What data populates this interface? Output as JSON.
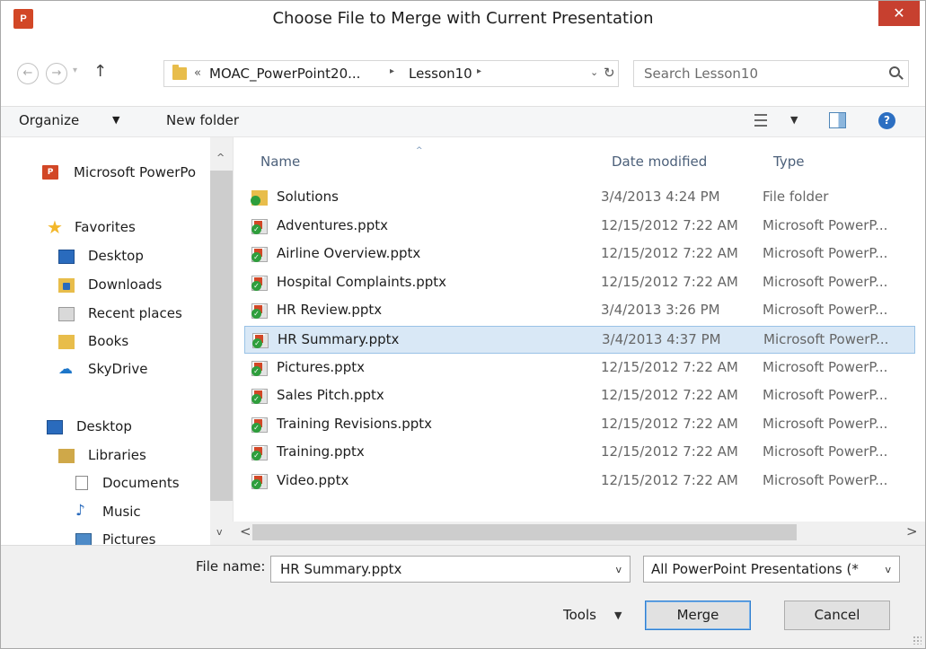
{
  "window": {
    "title": "Choose File to Merge with Current Presentation",
    "app_icon_text": "P",
    "close_label": "✕"
  },
  "navigation": {
    "back_label": "←",
    "forward_label": "→",
    "recent_label": "▾",
    "up_label": "↑",
    "address": {
      "overflow_label": "«",
      "segments": [
        "MOAC_PowerPoint20...",
        "Lesson10"
      ],
      "separator": "▸",
      "dropdown_label": "⌄",
      "refresh_label": "↻"
    },
    "search": {
      "placeholder": "Search Lesson10"
    }
  },
  "toolbar": {
    "organize_label": "Organize",
    "organize_caret": "▼",
    "new_folder_label": "New folder",
    "views_caret": "▼",
    "help_label": "?"
  },
  "nav_pane": {
    "items": [
      {
        "label": "Microsoft PowerPo",
        "icon": "ppt-icon"
      },
      {
        "label": "Favorites",
        "icon": "star-icon"
      },
      {
        "label": "Desktop",
        "icon": "desktop-icon"
      },
      {
        "label": "Downloads",
        "icon": "downloads-icon"
      },
      {
        "label": "Recent places",
        "icon": "recent-places-icon"
      },
      {
        "label": "Books",
        "icon": "folder-icon"
      },
      {
        "label": "SkyDrive",
        "icon": "cloud-icon"
      },
      {
        "label": "Desktop",
        "icon": "desktop-icon"
      },
      {
        "label": "Libraries",
        "icon": "libraries-icon"
      },
      {
        "label": "Documents",
        "icon": "document-icon"
      },
      {
        "label": "Music",
        "icon": "music-icon"
      },
      {
        "label": "Pictures",
        "icon": "pictures-icon"
      }
    ],
    "scroll_up": "^",
    "scroll_down": "v"
  },
  "file_list": {
    "columns": {
      "name": "Name",
      "date": "Date modified",
      "type": "Type"
    },
    "sort_indicator": "^",
    "rows": [
      {
        "name": "Solutions",
        "date": "3/4/2013 4:24 PM",
        "type": "File folder",
        "icon": "folder-icon"
      },
      {
        "name": "Adventures.pptx",
        "date": "12/15/2012 7:22 AM",
        "type": "Microsoft PowerP...",
        "icon": "pptx-file-icon"
      },
      {
        "name": "Airline Overview.pptx",
        "date": "12/15/2012 7:22 AM",
        "type": "Microsoft PowerP...",
        "icon": "pptx-file-icon"
      },
      {
        "name": "Hospital Complaints.pptx",
        "date": "12/15/2012 7:22 AM",
        "type": "Microsoft PowerP...",
        "icon": "pptx-file-icon"
      },
      {
        "name": "HR Review.pptx",
        "date": "3/4/2013 3:26 PM",
        "type": "Microsoft PowerP...",
        "icon": "pptx-file-icon"
      },
      {
        "name": "HR Summary.pptx",
        "date": "3/4/2013 4:37 PM",
        "type": "Microsoft PowerP...",
        "icon": "pptx-file-icon",
        "selected": true
      },
      {
        "name": "Pictures.pptx",
        "date": "12/15/2012 7:22 AM",
        "type": "Microsoft PowerP...",
        "icon": "pptx-file-icon"
      },
      {
        "name": "Sales Pitch.pptx",
        "date": "12/15/2012 7:22 AM",
        "type": "Microsoft PowerP...",
        "icon": "pptx-file-icon"
      },
      {
        "name": "Training Revisions.pptx",
        "date": "12/15/2012 7:22 AM",
        "type": "Microsoft PowerP...",
        "icon": "pptx-file-icon"
      },
      {
        "name": "Training.pptx",
        "date": "12/15/2012 7:22 AM",
        "type": "Microsoft PowerP...",
        "icon": "pptx-file-icon"
      },
      {
        "name": "Video.pptx",
        "date": "12/15/2012 7:22 AM",
        "type": "Microsoft PowerP...",
        "icon": "pptx-file-icon"
      }
    ],
    "hscroll_left": "<",
    "hscroll_right": ">"
  },
  "bottom": {
    "file_name_label": "File name:",
    "file_name_value": "HR Summary.pptx",
    "file_name_caret": "v",
    "file_type_value": "All PowerPoint Presentations (*",
    "file_type_caret": "v",
    "tools_label": "Tools",
    "tools_caret": "▼",
    "merge_label": "Merge",
    "cancel_label": "Cancel"
  },
  "colors": {
    "selection_fill": "#d9e8f6",
    "selection_border": "#99c2e6",
    "close_button": "#c7402f",
    "header_text": "#4c607a",
    "powerpoint_brand": "#d24726"
  }
}
